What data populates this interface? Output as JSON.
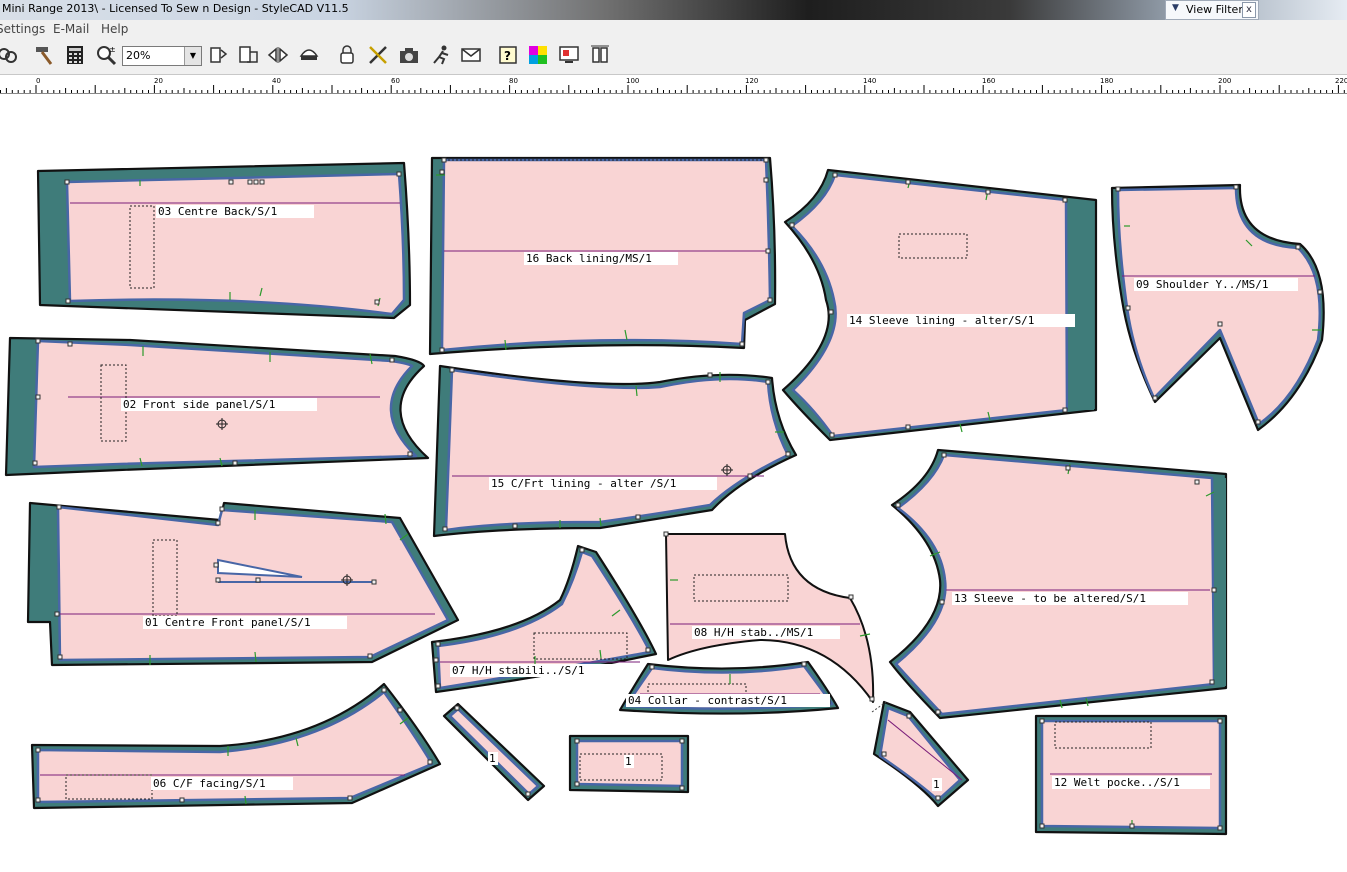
{
  "window": {
    "title": "Mini Range 2013\\ - Licensed To Sew n Design - StyleCAD V11.5"
  },
  "view_filter": {
    "label": "View Filter",
    "close": "x"
  },
  "menu": {
    "items": [
      "Settings",
      "E-Mail",
      "Help"
    ]
  },
  "toolbar": {
    "zoom_value": "20%"
  },
  "ruler": {
    "ticks": [
      "0",
      "20",
      "40",
      "60",
      "80",
      "100",
      "120",
      "140",
      "160",
      "180",
      "200",
      "220"
    ]
  },
  "pieces": [
    {
      "id": "03",
      "label": "03  Centre Back/S/1"
    },
    {
      "id": "16",
      "label": "16 Back lining/MS/1"
    },
    {
      "id": "14",
      "label": "14 Sleeve lining - alter/S/1"
    },
    {
      "id": "09",
      "label": "09 Shoulder Y../MS/1"
    },
    {
      "id": "02",
      "label": "02  Front side panel/S/1"
    },
    {
      "id": "15",
      "label": "15 C/Frt lining - alter /S/1"
    },
    {
      "id": "13",
      "label": "13 Sleeve - to be altered/S/1"
    },
    {
      "id": "01",
      "label": "01 Centre Front panel/S/1"
    },
    {
      "id": "07",
      "label": "07 H/H stabili../S/1"
    },
    {
      "id": "08",
      "label": "08 H/H stab../MS/1"
    },
    {
      "id": "04",
      "label": "04  Collar - contrast/S/1"
    },
    {
      "id": "06",
      "label": "06 C/F facing/S/1"
    },
    {
      "id": "12",
      "label": "12 Welt pocke../S/1"
    },
    {
      "id": "a",
      "label": "1"
    },
    {
      "id": "b",
      "label": "1"
    },
    {
      "id": "c",
      "label": "1"
    }
  ],
  "colors": {
    "fill": "#f9d4d4",
    "outline": "#2d6a69",
    "seam": "#4866a6",
    "grain": "#7a1e7a"
  }
}
